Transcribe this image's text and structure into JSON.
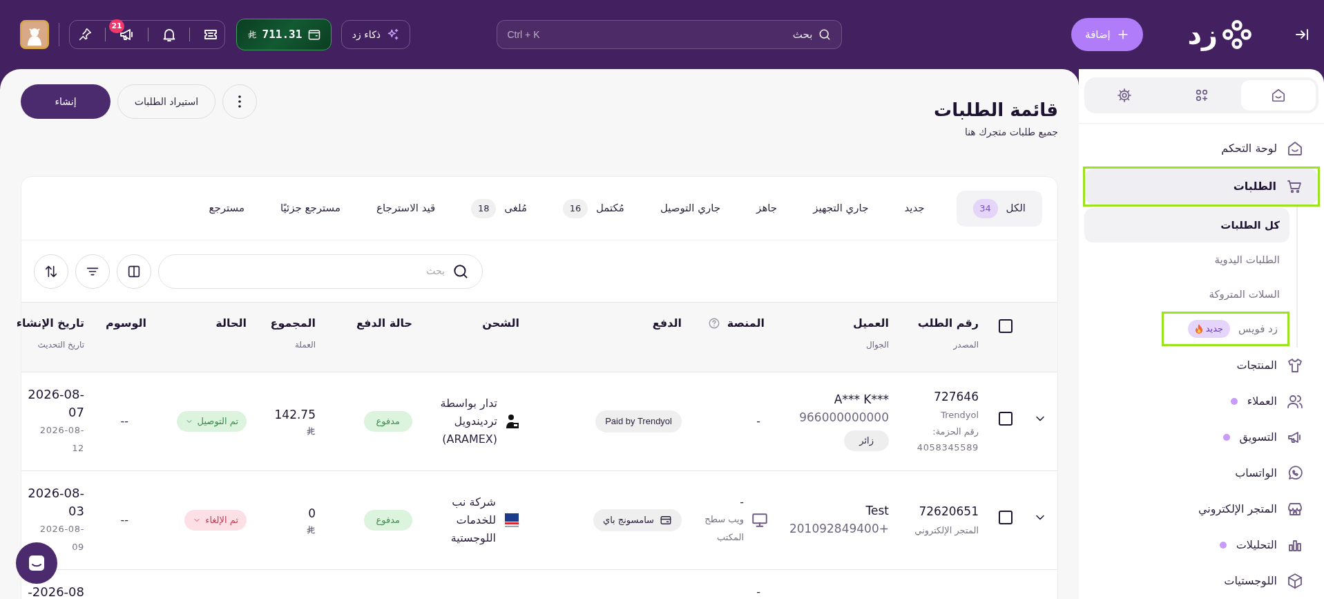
{
  "topbar": {
    "logo_text": "زد",
    "add_button": "إضافة",
    "search": {
      "placeholder": "بحث",
      "shortcut": "Ctrl + K"
    },
    "ai_button": "ذكاء زد",
    "wallet": "711.31",
    "announcements_badge": "21"
  },
  "page": {
    "title": "قائمة الطلبات",
    "subtitle": "جميع طلبات متجرك هنا",
    "buttons": [
      {
        "label": "استيراد الطلبات",
        "kind": "outline"
      },
      {
        "label": "إنشاء",
        "kind": "primary"
      }
    ]
  },
  "tabs": [
    {
      "label": "الكل",
      "count": "34",
      "selected": true
    },
    {
      "label": "جديد",
      "selected": false
    },
    {
      "label": "جاري التجهيز",
      "selected": false
    },
    {
      "label": "جاهز",
      "selected": false
    },
    {
      "label": "جاري التوصيل",
      "selected": false
    },
    {
      "label": "مُكتمل",
      "count": "16",
      "selected": false
    },
    {
      "label": "مُلغى",
      "count": "18",
      "selected": false
    },
    {
      "label": "قيد الاسترجاع",
      "selected": false
    },
    {
      "label": "مسترجع جزئيًا",
      "selected": false
    },
    {
      "label": "مسترجع",
      "selected": false
    }
  ],
  "search": {
    "placeholder": "بحث"
  },
  "table": {
    "select_all": {
      "checked": false
    },
    "columns": [
      {
        "title": "رقم الطلب",
        "subtitle": "المصدر",
        "help": false
      },
      {
        "title": "العميل",
        "subtitle": "الجوال",
        "help": false
      },
      {
        "title": "المنصة",
        "help": true
      },
      {
        "title": "الدفع",
        "help": false
      },
      {
        "title": "الشحن",
        "help": false
      },
      {
        "title": "حالة الدفع",
        "help": false
      },
      {
        "title": "المجموع",
        "subtitle": "العملة",
        "help": false
      },
      {
        "title": "الحالة",
        "help": false
      },
      {
        "title": "الوسوم",
        "help": false
      },
      {
        "title": "تاريخ الإنشاء",
        "subtitle": "تاريخ التحديث",
        "help": false
      }
    ],
    "rows": [
      {
        "expanded": false,
        "checked": false,
        "order": {
          "number": "727646",
          "source": "Trendyol",
          "package_label": "رقم الحزمة:",
          "package_number": "4058345589"
        },
        "customer": {
          "name": "***A*** K",
          "phone": "966000000000",
          "tag": "زائر"
        },
        "platform": {
          "kind": "none",
          "text": "-"
        },
        "payment": {
          "kind": "text",
          "label": "Paid by Trendyol"
        },
        "shipping": {
          "kind": "person",
          "label": "تدار بواسطة ترديندويل (ARAMEX)"
        },
        "payment_status": "مدفوع",
        "total": "142.75",
        "status": {
          "kind": "delivered",
          "label": "تم التوصيل"
        },
        "tags": "--",
        "created": "2026-08-07",
        "updated": "2026-08-12"
      },
      {
        "expanded": false,
        "checked": false,
        "order": {
          "number": "72620651",
          "source": "المتجر الإلكتروني"
        },
        "customer": {
          "name": "Test",
          "phone": "+201092849400"
        },
        "platform": {
          "kind": "desktop",
          "text": "-",
          "label": "ويب سطح المكتب"
        },
        "payment": {
          "kind": "card",
          "label": "سامسونج باي"
        },
        "shipping": {
          "kind": "logo",
          "label": "شركة نب للخدمات اللوجستية"
        },
        "payment_status": "مدفوع",
        "total": "0",
        "status": {
          "kind": "cancelled",
          "label": "تم الإلغاء"
        },
        "tags": "--",
        "created": "2026-08-03",
        "updated": "2026-08-09"
      },
      {
        "platform": {
          "kind": "none",
          "text": "-"
        },
        "created": "2026-08-"
      }
    ]
  },
  "sidebar": {
    "top_tabs": [
      {
        "selected": true
      },
      {
        "selected": false
      },
      {
        "selected": false
      }
    ],
    "items": [
      {
        "label": "لوحة التحكم",
        "selected": false,
        "highlighted": false,
        "dot": false
      },
      {
        "label": "الطلبات",
        "selected": true,
        "highlighted": true,
        "dot": false,
        "children": [
          {
            "label": "كل الطلبات",
            "selected": true,
            "highlighted": false
          },
          {
            "label": "الطلبات اليدوية",
            "selected": false,
            "highlighted": false
          },
          {
            "label": "السلات المتروكة",
            "selected": false,
            "highlighted": false
          },
          {
            "label": "زد فويس",
            "selected": false,
            "highlighted": true,
            "badge": "جديد"
          }
        ]
      },
      {
        "label": "المنتجات",
        "selected": false,
        "highlighted": false,
        "dot": false
      },
      {
        "label": "العملاء",
        "selected": false,
        "highlighted": false,
        "dot": true
      },
      {
        "label": "التسويق",
        "selected": false,
        "highlighted": false,
        "dot": true
      },
      {
        "label": "الواتساب",
        "selected": false,
        "highlighted": false,
        "dot": false
      },
      {
        "label": "المتجر الإلكتروني",
        "selected": false,
        "highlighted": false,
        "dot": false
      },
      {
        "label": "التحليلات",
        "selected": false,
        "highlighted": false,
        "dot": true
      },
      {
        "label": "اللوجستيات",
        "selected": false,
        "highlighted": false,
        "dot": false
      }
    ]
  }
}
